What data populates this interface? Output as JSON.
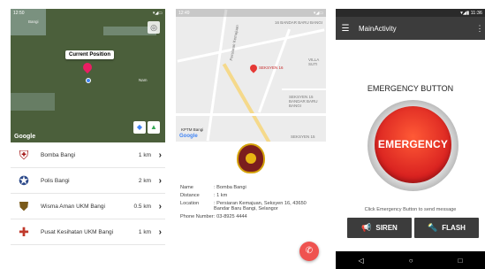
{
  "panel1": {
    "status_time": "12:50",
    "status_icons": "▾◢▭",
    "map": {
      "current_position_label": "Current Position",
      "place_labels": [
        "Bangi",
        "Nam"
      ],
      "google_logo": "Google"
    },
    "list": [
      {
        "name": "Bomba Bangi",
        "distance": "1 km",
        "icon": "fire-department-icon"
      },
      {
        "name": "Polis Bangi",
        "distance": "2 km",
        "icon": "police-icon"
      },
      {
        "name": "Wisma Aman UKM Bangi",
        "distance": "0.5 km",
        "icon": "security-icon"
      },
      {
        "name": "Pusat Kesihatan UKM Bangi",
        "distance": "1 km",
        "icon": "health-center-icon"
      }
    ]
  },
  "panel2": {
    "status_time": "12:49",
    "status_icons": "▾◢▭",
    "map": {
      "labels": [
        "16 BANDAR BARU BANGI",
        "SEKSYEN 16",
        "VILLA SUTI",
        "Persiaran Kemajuan",
        "SEKSYEN 15 BANDAR BARU BANGI",
        "KPTM Bangi",
        "SEKSYEN 15",
        "Google"
      ]
    },
    "details": [
      {
        "key": "Name",
        "value": ": Bomba Bangi"
      },
      {
        "key": "Distance",
        "value": ": 1 km"
      },
      {
        "key": "Location",
        "value": ": Persiaran Kemajuan, Seksyen 16, 43650 Bandar Baru Bangi, Selangor"
      },
      {
        "key": "Phone Number",
        "value": ": 03-8925 4444"
      }
    ],
    "fab_icon": "phone-icon"
  },
  "panel3": {
    "status": "▾◢▮ 11:36",
    "title": "MainActivity",
    "heading": "EMERGENCY BUTTON",
    "emergency_label": "EMERGENCY",
    "hint": "Click Emergency Button to send message",
    "siren_label": "SIREN",
    "flash_label": "FLASH",
    "nav": [
      "◁",
      "○",
      "□"
    ]
  },
  "colors": {
    "emergency_red": "#d71f1f",
    "toolbar": "#3c3c3c",
    "pin": "#e91e63"
  }
}
